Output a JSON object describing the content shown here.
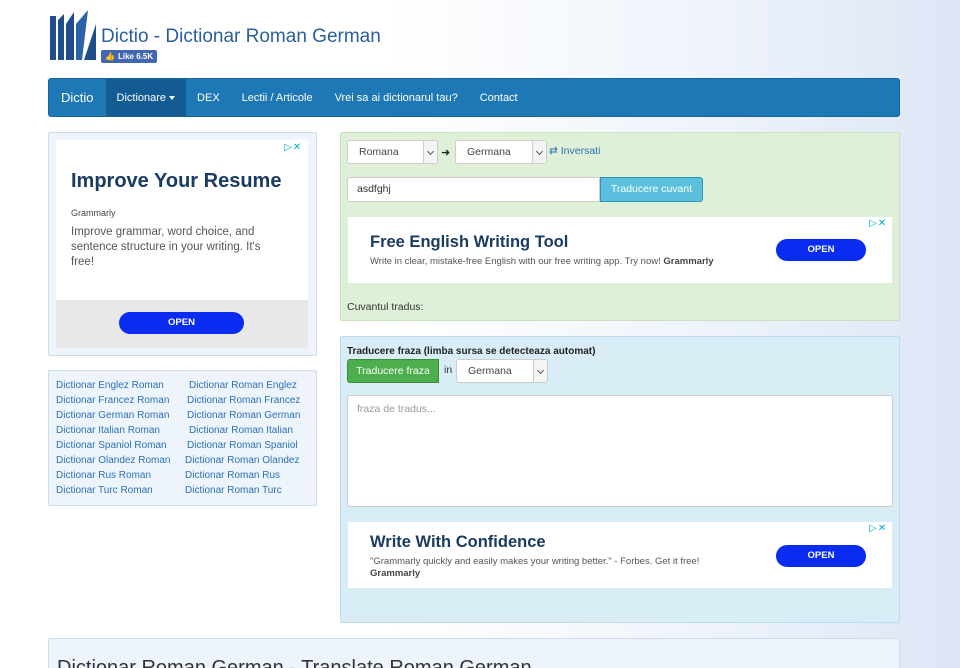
{
  "header": {
    "site_title": "Dictio - Dictionar Roman German",
    "fb_like": "Like 6.5K"
  },
  "nav": {
    "brand": "Dictio",
    "items": [
      "Dictionare",
      "DEX",
      "Lectii / Articole",
      "Vrei sa ai dictionarul tau?",
      "Contact"
    ]
  },
  "left_ad": {
    "headline": "Improve Your Resume",
    "brand": "Grammarly",
    "description": "Improve grammar, word choice, and sentence structure in your writing. It's free!",
    "button": "OPEN"
  },
  "dictionary_links": [
    {
      "left": "Dictionar Englez Roman",
      "right": "Dictionar Roman Englez"
    },
    {
      "left": "Dictionar Francez Roman",
      "right": "Dictionar Roman Francez"
    },
    {
      "left": "Dictionar German Roman",
      "right": "Dictionar Roman German"
    },
    {
      "left": "Dictionar Italian Roman",
      "right": "Dictionar Roman Italian"
    },
    {
      "left": "Dictionar Spaniol Roman",
      "right": "Dictionar Roman Spaniol"
    },
    {
      "left": "Dictionar Olandez Roman",
      "right": "Dictionar Roman Olandez"
    },
    {
      "left": "Dictionar Rus Roman",
      "right": "Dictionar Roman Rus"
    },
    {
      "left": "Dictionar Turc Roman",
      "right": "Dictionar Roman Turc"
    }
  ],
  "word_translate": {
    "source_language": "Romana",
    "target_language": "Germana",
    "swap_label": "Inversati",
    "input_value": "asdfghj",
    "button": "Traducere cuvant",
    "result_label": "Cuvantul tradus:"
  },
  "mid_ad": {
    "headline": "Free English Writing Tool",
    "text": "Write in clear, mistake-free English with our free writing app. Try now!",
    "brand": "Grammarly",
    "button": "OPEN"
  },
  "phrase_translate": {
    "title": "Traducere fraza (limba sursa se detecteaza automat)",
    "button": "Traducere fraza",
    "in_label": "in",
    "target_language": "Germana",
    "placeholder": "fraza de tradus..."
  },
  "bottom_ad": {
    "headline": "Write With Confidence",
    "text": "\"Grammarly quickly and easily makes your writing better.\" - Forbes. Get it free!",
    "brand": "Grammarly",
    "button": "OPEN"
  },
  "bottom_section": {
    "title": "Dictionar Roman German - Translate Roman German"
  },
  "colors": {
    "navbar": "#1e78b5",
    "accent_link": "#2a71b8",
    "ad_button": "#0a2bf0",
    "green_panel": "#dff0d8",
    "blue_panel": "#d9edf7"
  }
}
